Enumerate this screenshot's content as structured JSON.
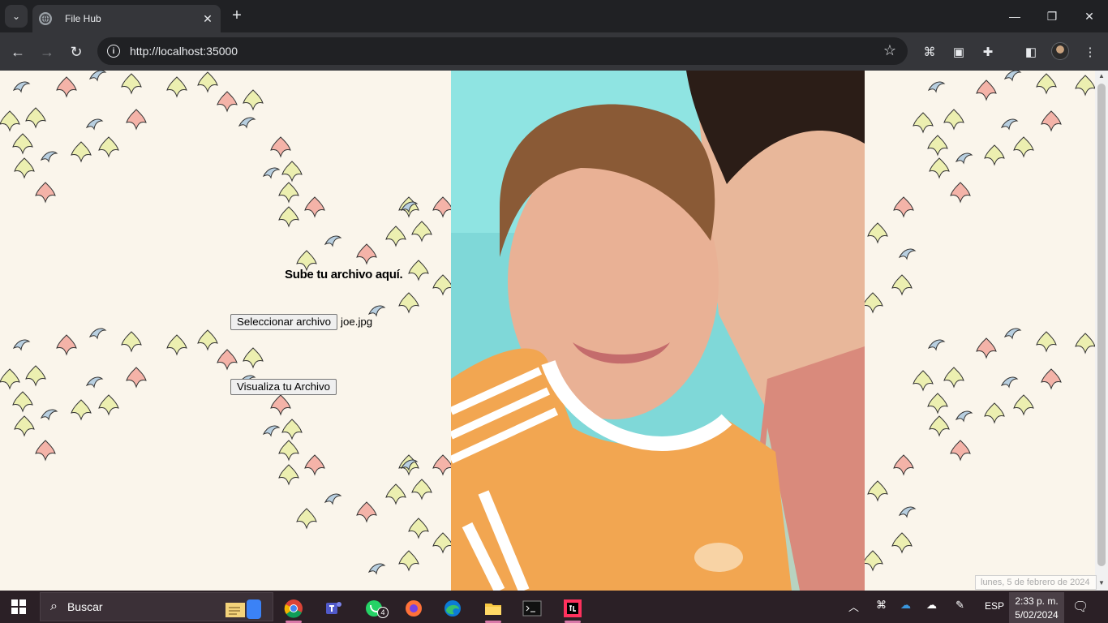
{
  "browser": {
    "tab_title": "File Hub",
    "url": "http://localhost:35000",
    "icons": [
      "tab-search-icon",
      "globe-icon",
      "close-icon",
      "new-tab-icon",
      "minimize-icon",
      "restore-icon",
      "window-close-icon",
      "back-icon",
      "forward-icon",
      "reload-icon",
      "site-info-icon",
      "bookmark-star-icon",
      "extension-icon",
      "puzzle-icon",
      "side-panel-icon",
      "profile-avatar",
      "menu-icon"
    ]
  },
  "page": {
    "upload_title": "Sube tu archivo aquí.",
    "file_button_label": "Seleccionar archivo",
    "selected_file": "joe.jpg",
    "view_button_label": "Visualiza tu Archivo",
    "date_tooltip": "lunes, 5 de febrero de 2024"
  },
  "taskbar": {
    "search_label": "Buscar",
    "whatsapp_badge": "4",
    "language": "ESP",
    "time": "2:33 p. m.",
    "date": "5/02/2024",
    "apps": [
      "start-icon",
      "search-icon",
      "notepad-icon",
      "chrome-icon",
      "teams-icon",
      "whatsapp-icon",
      "firefox-icon",
      "edge-icon",
      "file-explorer-icon",
      "terminal-icon",
      "intellij-icon"
    ]
  },
  "colors": {
    "chrome_dark": "#202124",
    "chrome_toolbar": "#35363a",
    "page_bg": "#faf5eb",
    "leaf_pink": "#f4b3a8",
    "leaf_yellow": "#ecefb0",
    "leaf_blue": "#b8cfe0",
    "taskbar": "#2b2026"
  }
}
